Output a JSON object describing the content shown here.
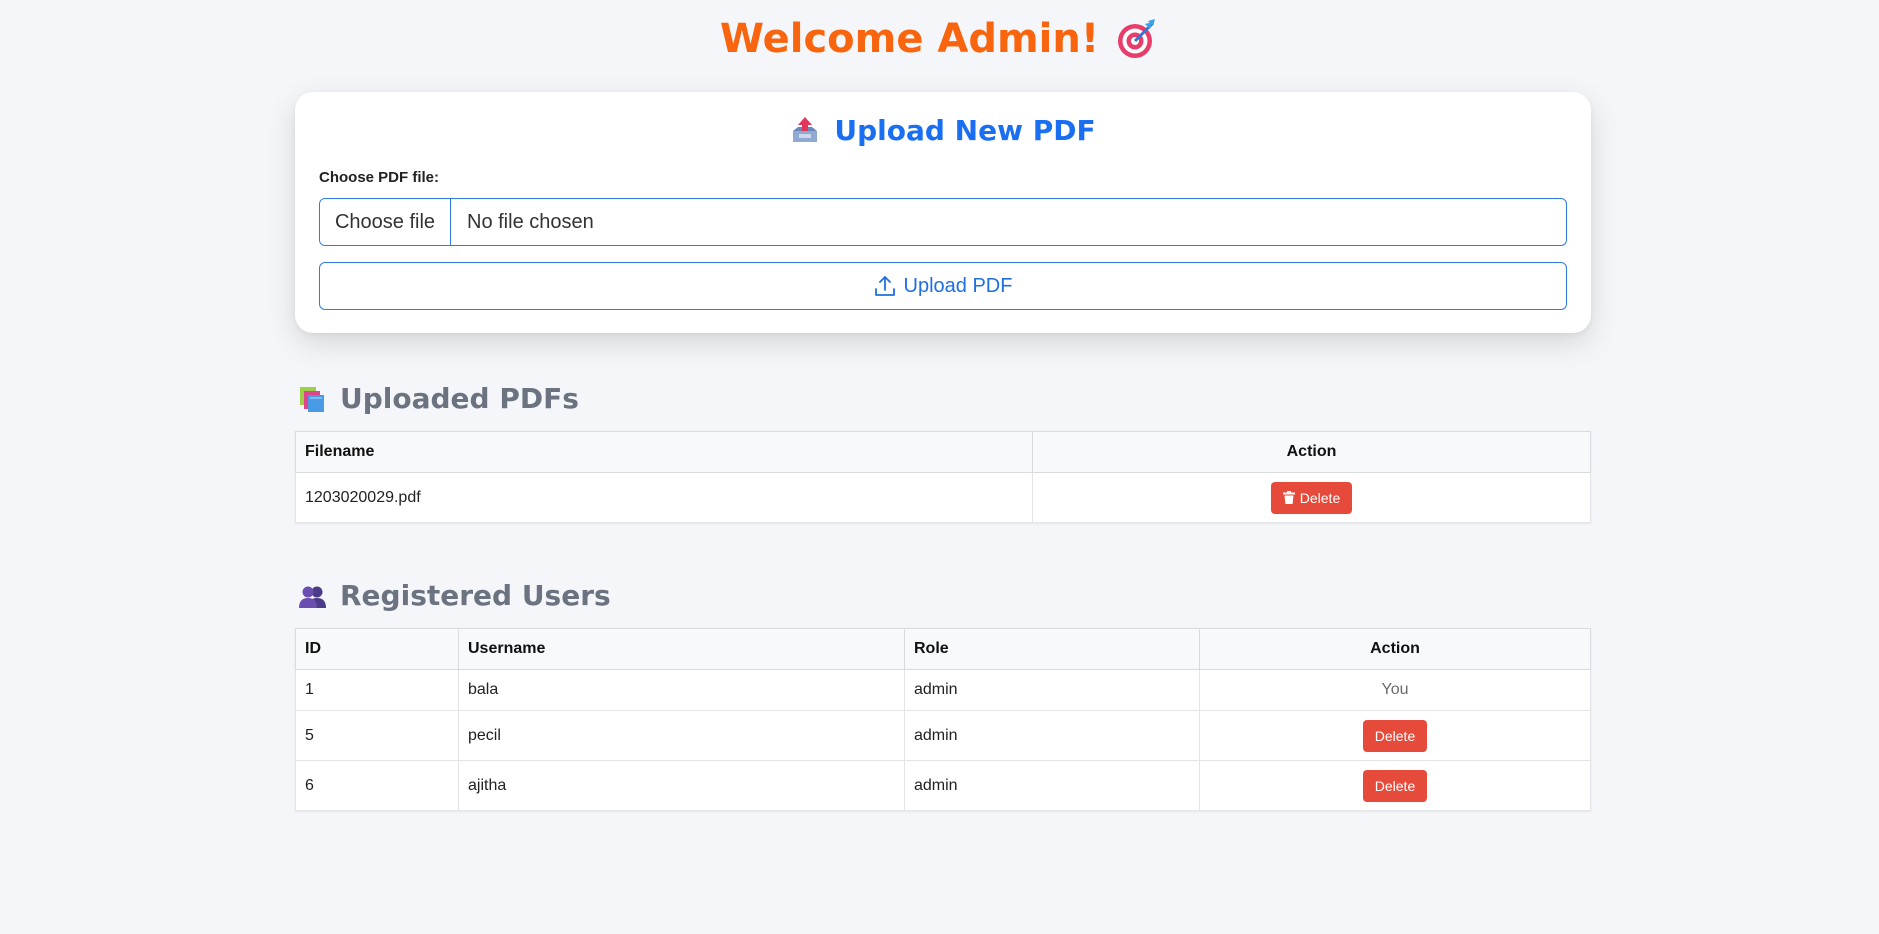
{
  "header": {
    "title": "Welcome Admin!",
    "icon": "target-icon"
  },
  "upload": {
    "title": "Upload New PDF",
    "label": "Choose PDF file:",
    "choose_button": "Choose file",
    "status": "No file chosen",
    "upload_button": "Upload PDF"
  },
  "pdfs": {
    "title": "Uploaded PDFs",
    "columns": [
      "Filename",
      "Action"
    ],
    "rows": [
      {
        "filename": "1203020029.pdf",
        "action": "Delete"
      }
    ]
  },
  "users": {
    "title": "Registered Users",
    "columns": [
      "ID",
      "Username",
      "Role",
      "Action"
    ],
    "rows": [
      {
        "id": "1",
        "username": "bala",
        "role": "admin",
        "action": "You"
      },
      {
        "id": "5",
        "username": "pecil",
        "role": "admin",
        "action": "Delete"
      },
      {
        "id": "6",
        "username": "ajitha",
        "role": "admin",
        "action": "Delete"
      }
    ]
  },
  "colors": {
    "title": "#f8650e",
    "accent": "#1a6ef2",
    "danger": "#e54a3a",
    "background": "#f5f6f9"
  }
}
